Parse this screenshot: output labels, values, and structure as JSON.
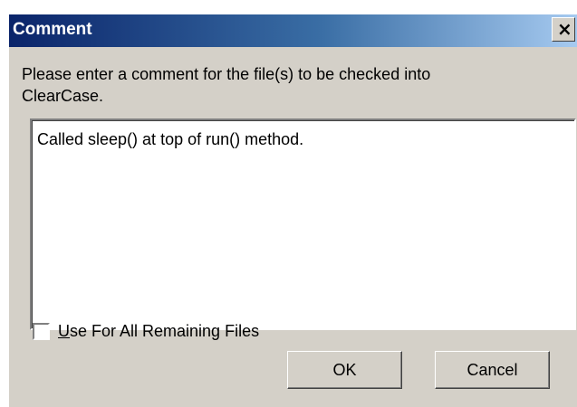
{
  "window": {
    "title": "Comment",
    "close_glyph": "×",
    "close_icon": "close-icon"
  },
  "prompt": {
    "line1": "Please enter a comment for the file(s) to be checked into",
    "line2": "ClearCase."
  },
  "comment": {
    "value": "Called sleep() at top of run() method."
  },
  "options": {
    "use_for_all": {
      "mnemonic": "U",
      "label_rest": "se For All Remaining Files",
      "checked": false
    }
  },
  "buttons": {
    "ok_label": "OK",
    "cancel_label": "Cancel"
  },
  "colors": {
    "title_bar_start": "#0a246a",
    "title_bar_end": "#a6caf0",
    "dialog_bg": "#d4d0c8"
  }
}
